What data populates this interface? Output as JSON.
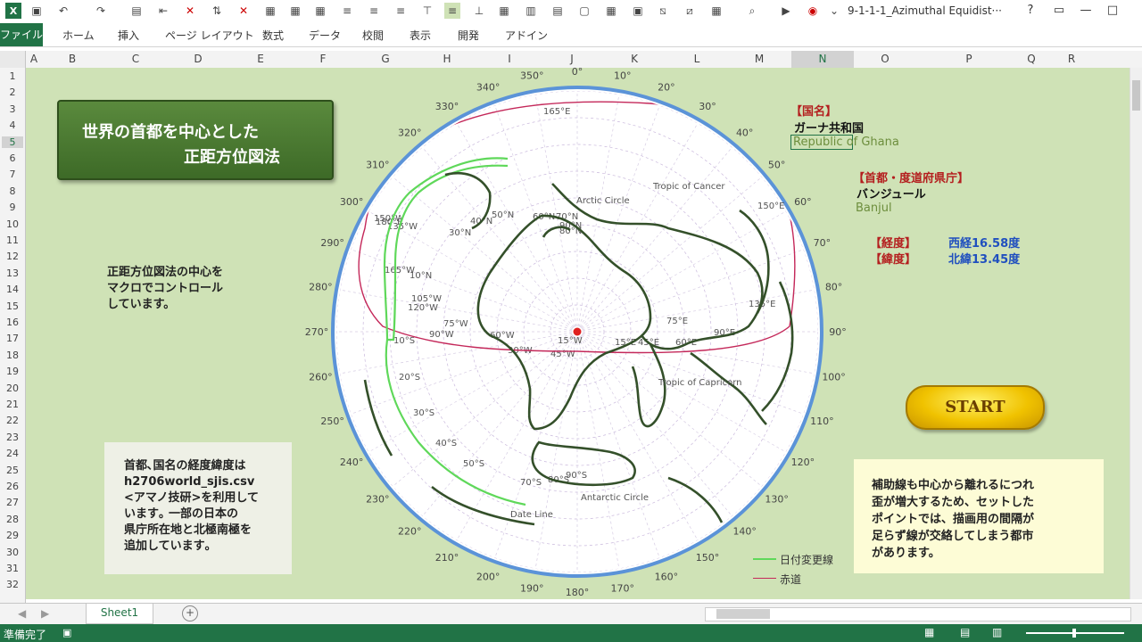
{
  "qat": {
    "filename": "9-1-1-1_Azimuthal Equidist···",
    "help": "?",
    "win_minimize": "—",
    "win_maximize": "□"
  },
  "ribbon": {
    "file_tab": "ファイル",
    "tabs": [
      "ホーム",
      "挿入",
      "ページ レイアウト",
      "数式",
      "データ",
      "校閲",
      "表示",
      "開発",
      "アドイン"
    ]
  },
  "grid": {
    "columns": [
      "A",
      "B",
      "C",
      "D",
      "E",
      "F",
      "G",
      "H",
      "I",
      "J",
      "K",
      "L",
      "M",
      "N",
      "O",
      "P",
      "Q",
      "R"
    ],
    "rows": [
      "1",
      "2",
      "3",
      "4",
      "5",
      "6",
      "7",
      "8",
      "9",
      "10",
      "11",
      "12",
      "13",
      "14",
      "15",
      "16",
      "17",
      "18",
      "19",
      "20",
      "21",
      "22",
      "23",
      "24",
      "25",
      "26",
      "27",
      "28",
      "29",
      "30",
      "31",
      "32"
    ]
  },
  "title_box": {
    "line1": "世界の首都を中心とした",
    "line2": "正距方位図法"
  },
  "info": {
    "country_label": "【国名】",
    "country_jp": "ガーナ共和国",
    "country_en": "Republic of Ghana",
    "capital_label": "【首都・度道府県庁】",
    "capital_jp": "バンジュール",
    "capital_en": "Banjul",
    "longitude_label": "【経度】",
    "longitude_value": "西経16.58度",
    "latitude_label": "【緯度】",
    "latitude_value": "北緯13.45度"
  },
  "notes": {
    "macro_note": [
      "正距方位図法の中心を",
      "マクロでコントロール",
      "しています。"
    ],
    "source_note": [
      "首都､国名の経度緯度は",
      "h2706world_sjis.csv",
      "<アマノ技研>を利用して",
      "います｡ 一部の日本の",
      "県庁所在地と北極南極を",
      "追加しています｡"
    ],
    "warning_note": [
      "補助線も中心から離れるにつれ",
      "歪が増大するため、セットした",
      "ポイントでは、描画用の間隔が",
      "足らず線が交絡してしまう都市",
      "があります。"
    ]
  },
  "start_button": "START",
  "map": {
    "bearing_labels": [
      "0°",
      "10°",
      "20°",
      "30°",
      "40°",
      "50°",
      "60°",
      "70°",
      "80°",
      "90°",
      "100°",
      "110°",
      "120°",
      "130°",
      "140°",
      "150°",
      "160°",
      "170°",
      "180°",
      "190°",
      "200°",
      "210°",
      "220°",
      "230°",
      "240°",
      "250°",
      "260°",
      "270°",
      "280°",
      "290°",
      "300°",
      "310°",
      "320°",
      "330°",
      "340°",
      "350°"
    ],
    "meridian_labels": [
      "165°E",
      "150°E",
      "135°E",
      "90°E",
      "75°E",
      "60°E",
      "45°E",
      "15°E",
      "15°W",
      "45°W",
      "30°W",
      "60°W",
      "75°W",
      "90°W",
      "105°W",
      "120°W",
      "135°W",
      "150°W",
      "165°W",
      "180°E"
    ],
    "parallel_labels": [
      "10°N",
      "30°N",
      "40°N",
      "50°N",
      "60°N",
      "70°N",
      "80°N",
      "90°N",
      "10°S",
      "20°S",
      "30°S",
      "40°S",
      "50°S",
      "70°S",
      "80°S",
      "90°S"
    ],
    "circle_labels": [
      "Arctic Circle",
      "Tropic of Cancer",
      "Tropic of Capricorn",
      "Antarctic Circle",
      "Date Line"
    ],
    "colors": {
      "land": "#34502a",
      "dateline": "#5fd85a",
      "equator": "#c4285a",
      "rim": "#5b93d8",
      "center": "#e02020"
    }
  },
  "legend": {
    "dateline": "日付変更線",
    "equator": "赤道"
  },
  "sheet_tabs": [
    "Sheet1"
  ],
  "status": {
    "ready": "準備完了"
  }
}
